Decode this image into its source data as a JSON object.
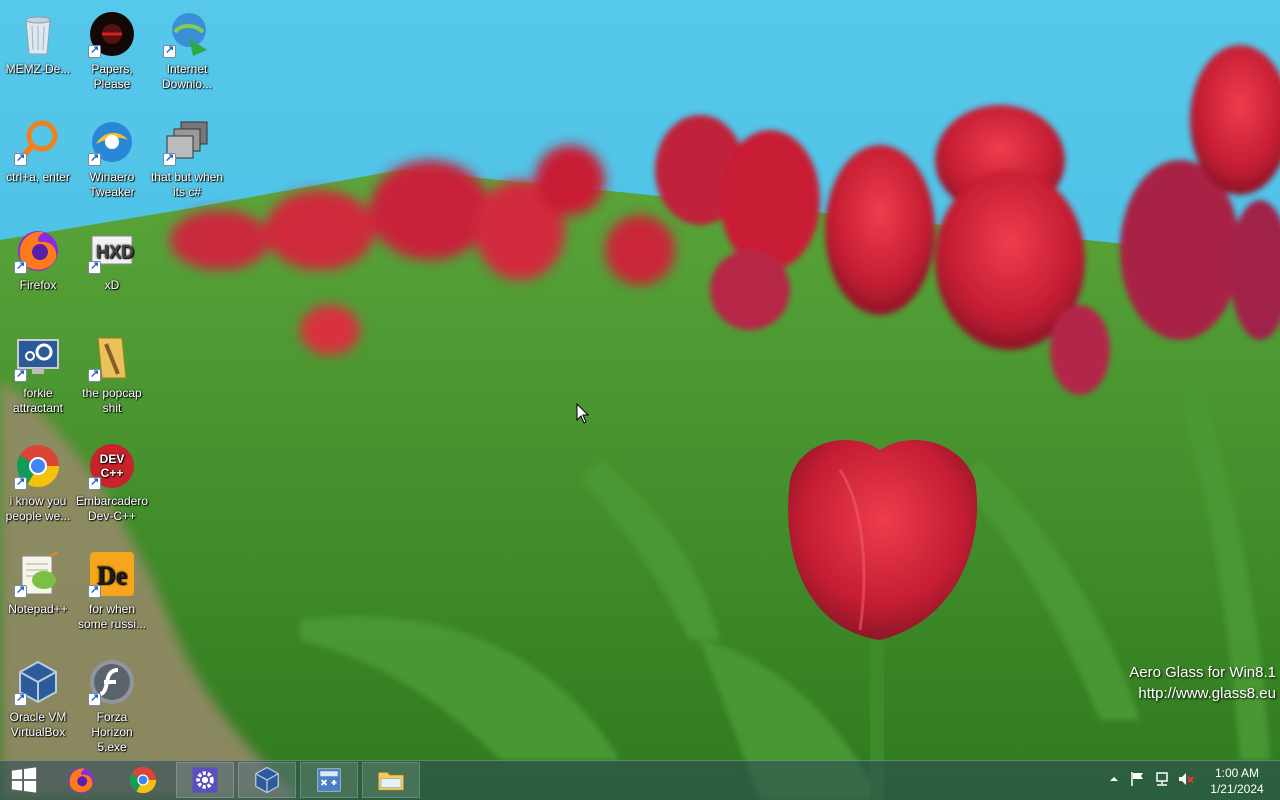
{
  "desktop": {
    "icons": [
      {
        "label": "MEMZ-De...",
        "icon": "recycle-bin-icon"
      },
      {
        "label": "Papers, Please",
        "icon": "papers-please-icon"
      },
      {
        "label": "Internet Downlo...",
        "icon": "internet-download-manager-icon"
      },
      {
        "label": "ctrl+a, enter",
        "icon": "magnifier-icon"
      },
      {
        "label": "Winaero Tweaker",
        "icon": "winaero-tweaker-icon"
      },
      {
        "label": "that but when its c#",
        "icon": "stacked-windows-icon"
      },
      {
        "label": "Firefox",
        "icon": "firefox-icon"
      },
      {
        "label": "xD",
        "icon": "hxd-icon"
      },
      {
        "label": "forkie attractant",
        "icon": "computer-settings-icon"
      },
      {
        "label": "the popcap shit",
        "icon": "folder-icon"
      },
      {
        "label": "i know you people we...",
        "icon": "chrome-icon"
      },
      {
        "label": "Embarcadero Dev-C++",
        "icon": "devcpp-icon"
      },
      {
        "label": "Notepad++",
        "icon": "notepadpp-icon"
      },
      {
        "label": "for when some russi...",
        "icon": "de-icon"
      },
      {
        "label": "Oracle VM VirtualBox",
        "icon": "virtualbox-icon"
      },
      {
        "label": "Forza Horizon 5.exe",
        "icon": "flash-icon"
      }
    ]
  },
  "watermark": {
    "line1": "Aero Glass for Win8.1",
    "line2": "http://www.glass8.eu"
  },
  "taskbar": {
    "buttons": [
      {
        "name": "start-button",
        "icon": "windows-logo-icon"
      },
      {
        "name": "firefox",
        "icon": "firefox-icon"
      },
      {
        "name": "chrome",
        "icon": "chrome-icon"
      },
      {
        "name": "settings",
        "icon": "gear-icon"
      },
      {
        "name": "virtualbox",
        "icon": "virtualbox-icon"
      },
      {
        "name": "calculator",
        "icon": "calculator-icon"
      },
      {
        "name": "file-explorer",
        "icon": "folder-icon"
      }
    ],
    "tray": [
      "chevron-up-icon",
      "flag-icon",
      "network-icon",
      "speaker-muted-icon"
    ],
    "clock": {
      "time": "1:00 AM",
      "date": "1/21/2024"
    }
  },
  "colors": {
    "accent": "#d3223a",
    "sky": "#4fc4e6",
    "grass": "#3f8f2a"
  }
}
